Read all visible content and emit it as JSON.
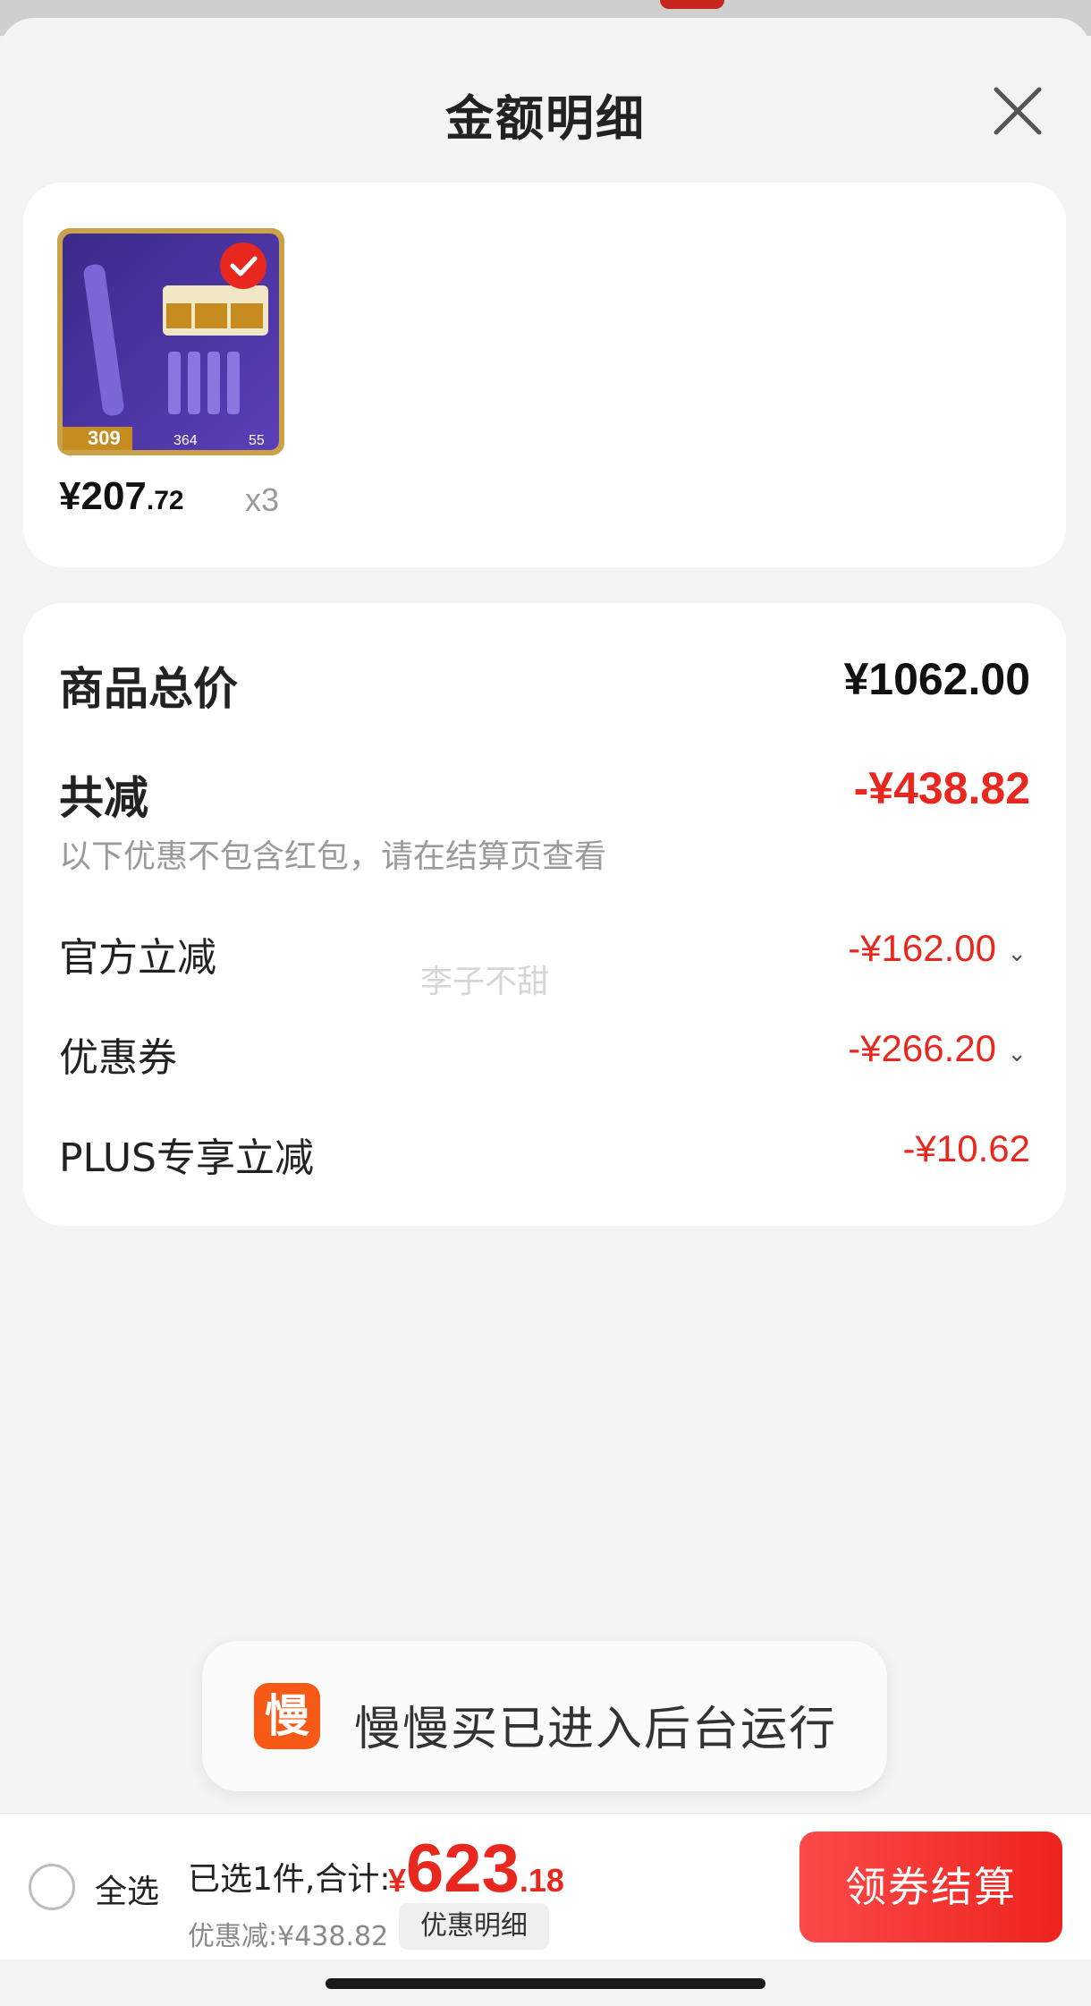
{
  "header": {
    "title": "金额明细"
  },
  "product": {
    "image_alt": "L'OREAL eye cream product image",
    "unit_price_int": "¥207",
    "unit_price_dec": ".72",
    "quantity": "x3"
  },
  "summary": {
    "total_label": "商品总价",
    "total_value": "¥1062.00",
    "reduce_label": "共减",
    "reduce_value": "-¥438.82",
    "note": "以下优惠不包含红包，请在结算页查看",
    "items": [
      {
        "label": "官方立减",
        "value": "-¥162.00",
        "expandable": true
      },
      {
        "label": "优惠券",
        "value": "-¥266.20",
        "expandable": true
      },
      {
        "label": "PLUS专享立减",
        "value": "-¥10.62",
        "expandable": false
      }
    ]
  },
  "watermark": "李子不甜",
  "toast": {
    "icon_char": "慢",
    "text": "慢慢买已进入后台运行"
  },
  "bottom_bar": {
    "select_all_label": "全选",
    "selected_info": "已选1件,合计:",
    "total_currency": "¥",
    "total_int": "623",
    "total_dec": ".18",
    "discount_line": "优惠减:¥438.82",
    "detail_chip": "优惠明细",
    "checkout_label": "领券结算"
  },
  "colors": {
    "accent_red": "#e8281e",
    "toast_icon": "#f75a16"
  }
}
